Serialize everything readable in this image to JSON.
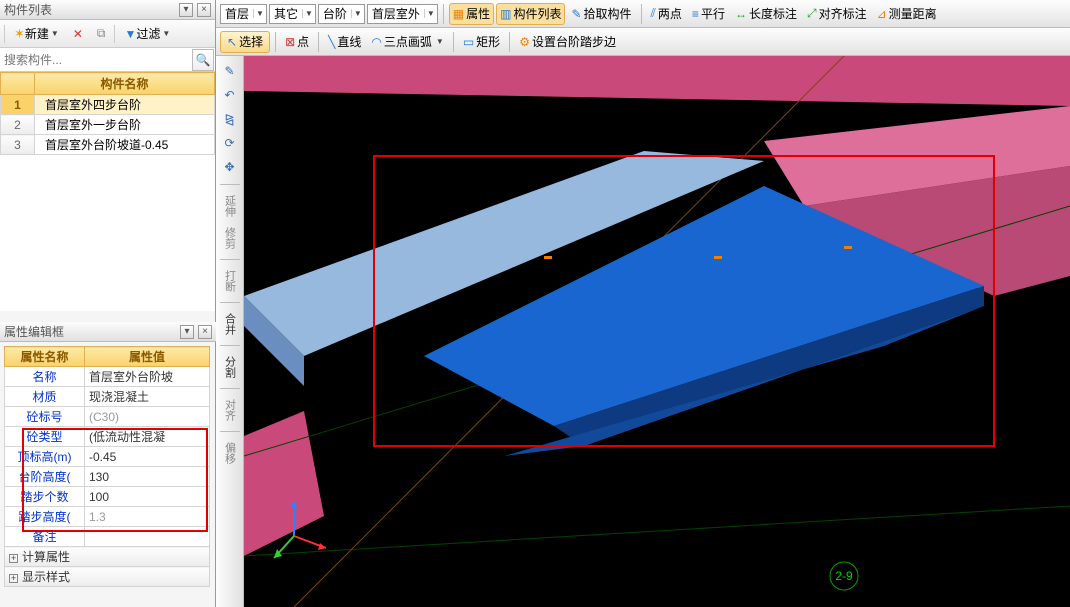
{
  "left": {
    "panel1_title": "构件列表",
    "new_btn": "新建",
    "filter_btn": "过滤",
    "search_placeholder": "搜索构件...",
    "col_header": "构件名称",
    "rows": [
      {
        "n": "1",
        "name": "首层室外四步台阶"
      },
      {
        "n": "2",
        "name": "首层室外一步台阶"
      },
      {
        "n": "3",
        "name": "首层室外台阶坡道-0.45"
      }
    ],
    "panel2_title": "属性编辑框",
    "prop_col1": "属性名称",
    "prop_col2": "属性值",
    "props": [
      {
        "k": "名称",
        "v": "首层室外台阶坡"
      },
      {
        "k": "材质",
        "v": "现浇混凝土"
      },
      {
        "k": "砼标号",
        "v": "(C30)",
        "gray": true
      },
      {
        "k": "砼类型",
        "v": "(低流动性混凝"
      },
      {
        "k": "顶标高(m)",
        "v": "-0.45"
      },
      {
        "k": "台阶高度(",
        "v": "130"
      },
      {
        "k": "踏步个数",
        "v": "100"
      },
      {
        "k": "踏步高度(",
        "v": "1.3",
        "gray": true
      },
      {
        "k": "备注",
        "v": ""
      }
    ],
    "exp1": "计算属性",
    "exp2": "显示样式"
  },
  "top": {
    "combo1": "首层",
    "combo2": "其它",
    "combo3": "台阶",
    "combo4": "首层室外",
    "btn_prop": "属性",
    "btn_list": "构件列表",
    "btn_pick": "拾取构件",
    "btn_2pt": "两点",
    "btn_par": "平行",
    "btn_len": "长度标注",
    "btn_align": "对齐标注",
    "btn_meas": "测量距离"
  },
  "second": {
    "sel": "选择",
    "pt": "点",
    "line": "直线",
    "arc": "三点画弧",
    "rect": "矩形",
    "set": "设置台阶踏步边"
  },
  "side": {
    "l1": "延伸",
    "l2": "修剪",
    "l3": "打断",
    "l4": "合并",
    "l5": "分割",
    "l6": "对齐",
    "l7": "偏移"
  },
  "axis_label": "2-9"
}
